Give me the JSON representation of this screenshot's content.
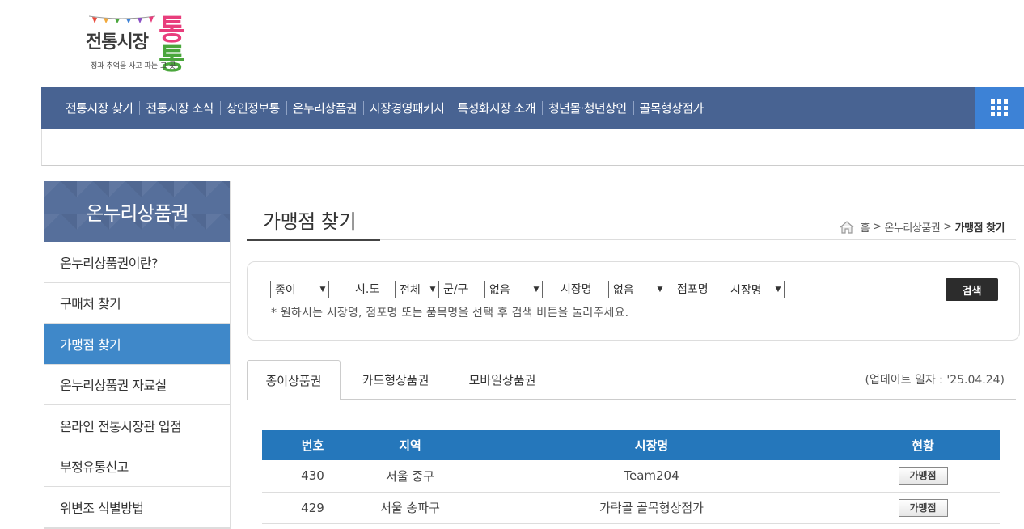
{
  "logo": {
    "main_text": "전통시장",
    "brand_t1": "통",
    "brand_t2": "통",
    "subtitle": "정과 추억을 사고 파는 그 곳"
  },
  "nav": {
    "items": [
      "전통시장 찾기",
      "전통시장 소식",
      "상인정보통",
      "온누리상품권",
      "시장경영패키지",
      "특성화시장 소개",
      "청년몰·청년상인",
      "골목형상점가"
    ],
    "all_menu_icon": "grid-menu-icon"
  },
  "sidebar": {
    "title": "온누리상품권",
    "items": [
      {
        "label": "온누리상품권이란?",
        "active": false
      },
      {
        "label": "구매처 찾기",
        "active": false
      },
      {
        "label": "가맹점 찾기",
        "active": true
      },
      {
        "label": "온누리상품권 자료실",
        "active": false
      },
      {
        "label": "온라인 전통시장관 입점",
        "active": false
      },
      {
        "label": "부정유통신고",
        "active": false
      },
      {
        "label": "위변조 식별방법",
        "active": false
      }
    ]
  },
  "page": {
    "title": "가맹점 찾기",
    "breadcrumb": {
      "home": "홈",
      "section": "온누리상품권",
      "current": "가맹점 찾기"
    }
  },
  "search": {
    "type_value": "종이",
    "sido_label": "시.도",
    "sido_value": "전체",
    "gungu_label": "군/구",
    "gungu_value": "없음",
    "market_label": "시장명",
    "market_value": "없음",
    "store_label": "점포명",
    "store_value": "시장명",
    "keyword_value": "",
    "button_label": "검색",
    "note": "* 원하시는 시장명, 점포명 또는 품목명을 선택 후 검색 버튼을 눌러주세요."
  },
  "tabs": {
    "items": [
      "종이상품권",
      "카드형상품권",
      "모바일상품권"
    ],
    "active_index": 0,
    "update_text": "(업데이트 일자 : '25.04.24)"
  },
  "table": {
    "headers": [
      "번호",
      "지역",
      "시장명",
      "현황"
    ],
    "rows": [
      {
        "no": "430",
        "region": "서울 중구",
        "market": "Team204",
        "status_button": "가맹점"
      },
      {
        "no": "429",
        "region": "서울 송파구",
        "market": "가락골 골목형상점가",
        "status_button": "가맹점"
      }
    ]
  },
  "colors": {
    "nav_bg": "#486392",
    "all_menu_bg": "#3d82d6",
    "sidebar_active": "#3f88c9",
    "table_header": "#2577bb"
  }
}
